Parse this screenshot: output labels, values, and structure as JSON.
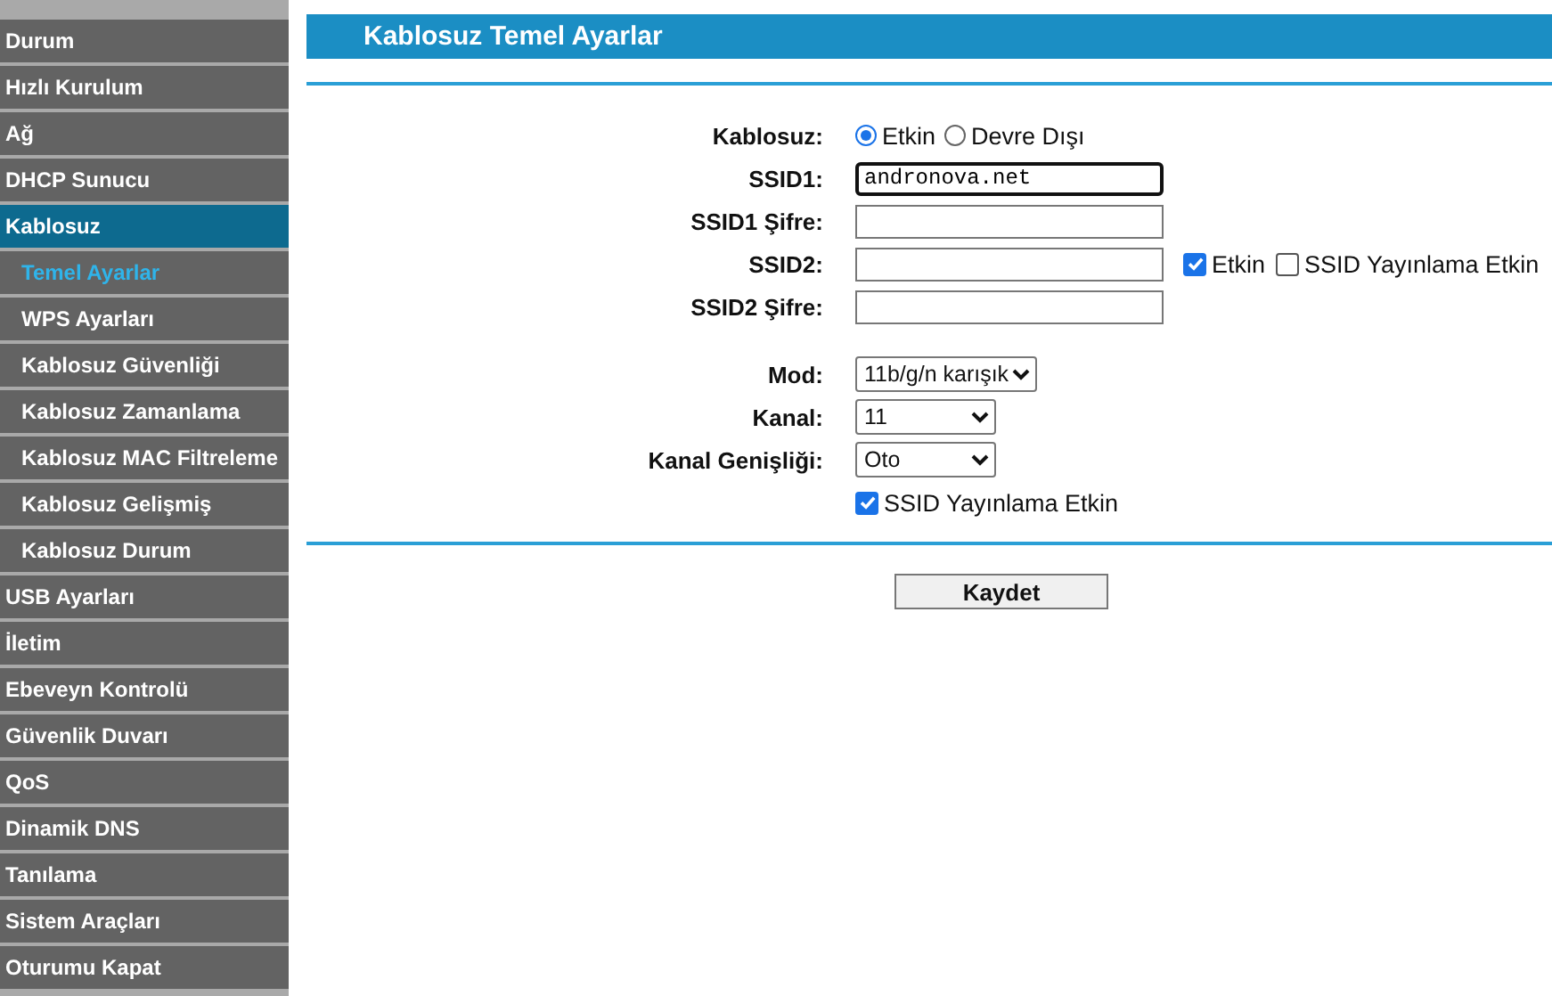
{
  "sidebar": {
    "items": [
      {
        "label": "Durum",
        "selected": false
      },
      {
        "label": "Hızlı Kurulum",
        "selected": false
      },
      {
        "label": "Ağ",
        "selected": false
      },
      {
        "label": "DHCP Sunucu",
        "selected": false
      },
      {
        "label": "Kablosuz",
        "selected": true,
        "children": [
          {
            "label": "Temel Ayarlar",
            "selected": true
          },
          {
            "label": "WPS Ayarları",
            "selected": false
          },
          {
            "label": "Kablosuz Güvenliği",
            "selected": false
          },
          {
            "label": "Kablosuz Zamanlama",
            "selected": false
          },
          {
            "label": "Kablosuz MAC Filtreleme",
            "selected": false
          },
          {
            "label": "Kablosuz Gelişmiş",
            "selected": false
          },
          {
            "label": "Kablosuz Durum",
            "selected": false
          }
        ]
      },
      {
        "label": "USB Ayarları",
        "selected": false
      },
      {
        "label": "İletim",
        "selected": false
      },
      {
        "label": "Ebeveyn Kontrolü",
        "selected": false
      },
      {
        "label": "Güvenlik Duvarı",
        "selected": false
      },
      {
        "label": "QoS",
        "selected": false
      },
      {
        "label": "Dinamik DNS",
        "selected": false
      },
      {
        "label": "Tanılama",
        "selected": false
      },
      {
        "label": "Sistem Araçları",
        "selected": false
      },
      {
        "label": "Oturumu Kapat",
        "selected": false
      }
    ]
  },
  "page": {
    "title": "Kablosuz Temel Ayarlar"
  },
  "form": {
    "rows": [
      {
        "kind": "radio",
        "label": "Kablosuz:",
        "options": [
          {
            "label": "Etkin",
            "selected": true
          },
          {
            "label": "Devre Dışı",
            "selected": false
          }
        ]
      },
      {
        "kind": "text",
        "label": "SSID1:",
        "value": "andronova.net",
        "focused": true
      },
      {
        "kind": "text",
        "label": "SSID1 Şifre:",
        "focused": false
      },
      {
        "kind": "text",
        "label": "SSID2:",
        "focused": false,
        "checkboxes": [
          {
            "label": "Etkin",
            "checked": true
          },
          {
            "label": "SSID Yayınlama Etkin",
            "checked": false
          }
        ]
      },
      {
        "kind": "text",
        "label": "SSID2 Şifre:",
        "focused": false
      },
      {
        "kind": "select",
        "label": "Mod:",
        "value": "11b/g/n karışık"
      },
      {
        "kind": "select",
        "label": "Kanal:",
        "value": "11"
      },
      {
        "kind": "select",
        "label": "Kanal Genişliği:",
        "value": "Oto"
      },
      {
        "kind": "checkbox",
        "label": "SSID Yayınlama Etkin",
        "checked": true
      }
    ]
  },
  "save_button": "Kaydet"
}
